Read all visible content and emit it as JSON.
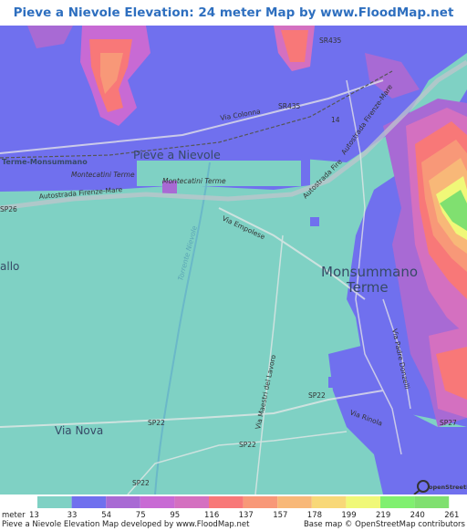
{
  "title": "Pieve a Nievole Elevation: 24 meter Map by www.FloodMap.net (beta)",
  "map": {
    "places": {
      "pieve": "Pieve a Nievole",
      "monsummano": "Monsummano",
      "terme": "Terme",
      "vianova": "Via Nova",
      "allo": "allo",
      "station": "Terme-Monsummano"
    },
    "roads": {
      "sr435a": "SR435",
      "sr435b": "SR435",
      "viacolonna": "Via Colonna",
      "n14": "14",
      "autostrada": "Autostrada Firenze-Mare",
      "autostrada2": "Autostrada Firenze-Mare",
      "autostrada3": "Autostrada Fire",
      "montecatini1": "Montecatini Terme",
      "montecatini2": "Montecatini Terme",
      "sp26": "SP26",
      "empolese": "Via Empolese",
      "torrente": "Torrente Nievole",
      "maestri": "Via Maestri del Lavoro",
      "donzelli": "Via Padre Donzelli",
      "rinola": "Via Rinola",
      "sp22a": "SP22",
      "sp22b": "SP22",
      "sp22c": "SP22",
      "sp22d": "SP22",
      "sp27": "SP27"
    },
    "osm_logo": "openStreetMap"
  },
  "legend": {
    "unit": "meter",
    "values": [
      "13",
      "33",
      "54",
      "75",
      "95",
      "116",
      "137",
      "157",
      "178",
      "199",
      "219",
      "240",
      "261"
    ],
    "colors": [
      "#7fd1c4",
      "#7070ee",
      "#a86ad4",
      "#c86ad4",
      "#d470c0",
      "#f87878",
      "#f89878",
      "#f8b878",
      "#f8d878",
      "#f0f878",
      "#80f070",
      "#80e070"
    ],
    "footer_left": "Pieve a Nievole Elevation Map developed by www.FloodMap.net",
    "footer_right": "Base map © OpenStreetMap contributors"
  }
}
